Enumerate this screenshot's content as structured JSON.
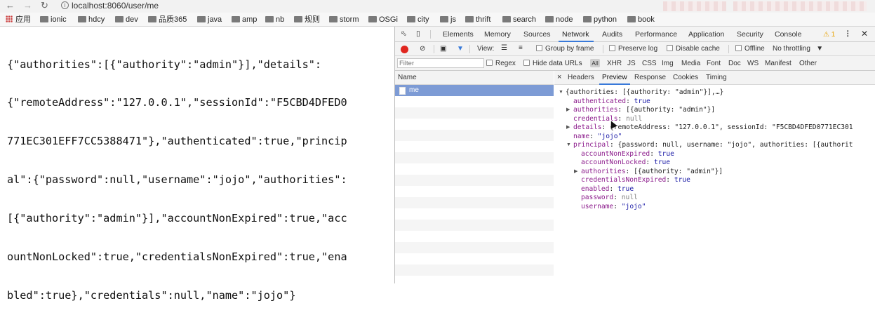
{
  "browser": {
    "url": "localhost:8060/user/me",
    "bookmarks": [
      "应用",
      "ionic",
      "hdcy",
      "dev",
      "品质365",
      "java",
      "amp",
      "nb",
      "规则",
      "storm",
      "OSGi",
      "city",
      "js",
      "thrift",
      "search",
      "node",
      "python",
      "book"
    ]
  },
  "page": {
    "json_lines": [
      "{\"authorities\":[{\"authority\":\"admin\"}],\"details\":",
      "{\"remoteAddress\":\"127.0.0.1\",\"sessionId\":\"F5CBD4DFED0",
      "771EC301EFF7CC5388471\"},\"authenticated\":true,\"princip",
      "al\":{\"password\":null,\"username\":\"jojo\",\"authorities\":",
      "[{\"authority\":\"admin\"}],\"accountNonExpired\":true,\"acc",
      "ountNonLocked\":true,\"credentialsNonExpired\":true,\"ena",
      "bled\":true},\"credentials\":null,\"name\":\"jojo\"}"
    ]
  },
  "devtools": {
    "tabs": [
      "Elements",
      "Memory",
      "Sources",
      "Network",
      "Audits",
      "Performance",
      "Application",
      "Security",
      "Console"
    ],
    "active_tab": "Network",
    "warning_count": "1",
    "toolbar": {
      "view_label": "View:",
      "group_by_frame": "Group by frame",
      "preserve_log": "Preserve log",
      "disable_cache": "Disable cache",
      "offline": "Offline",
      "throttling": "No throttling"
    },
    "filter": {
      "placeholder": "Filter",
      "regex": "Regex",
      "hide_data_urls": "Hide data URLs",
      "types": [
        "All",
        "XHR",
        "JS",
        "CSS",
        "Img",
        "Media",
        "Font",
        "Doc",
        "WS",
        "Manifest",
        "Other"
      ]
    },
    "requests": {
      "column_header": "Name",
      "items": [
        "me"
      ]
    },
    "detail_tabs": [
      "Headers",
      "Preview",
      "Response",
      "Cookies",
      "Timing"
    ],
    "active_detail_tab": "Preview",
    "preview": {
      "root": "{authorities: [{authority: \"admin\"}],…}",
      "authenticated_key": "authenticated",
      "authenticated_val": "true",
      "authorities_key": "authorities",
      "authorities_val": "[{authority: \"admin\"}]",
      "credentials_key": "credentials",
      "credentials_val": "null",
      "details_key": "details",
      "details_val": "{remoteAddress: \"127.0.0.1\", sessionId: \"F5CBD4DFED0771EC301",
      "name_key": "name",
      "name_val": "\"jojo\"",
      "principal_key": "principal",
      "principal_val": "{password: null, username: \"jojo\", authorities: [{authorit",
      "p_accountNonExpired_key": "accountNonExpired",
      "p_accountNonExpired_val": "true",
      "p_accountNonLocked_key": "accountNonLocked",
      "p_accountNonLocked_val": "true",
      "p_authorities_key": "authorities",
      "p_authorities_val": "[{authority: \"admin\"}]",
      "p_credentialsNonExpired_key": "credentialsNonExpired",
      "p_credentialsNonExpired_val": "true",
      "p_enabled_key": "enabled",
      "p_enabled_val": "true",
      "p_password_key": "password",
      "p_password_val": "null",
      "p_username_key": "username",
      "p_username_val": "\"jojo\""
    }
  }
}
